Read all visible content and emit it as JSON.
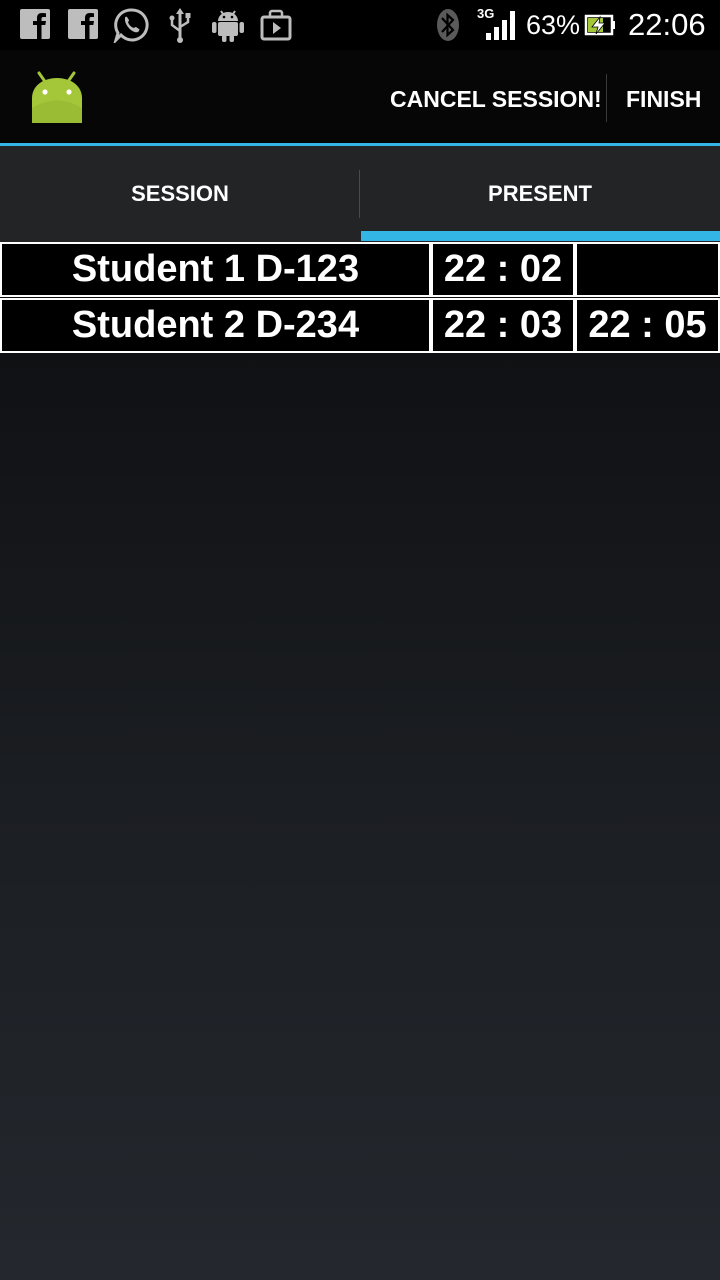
{
  "status_bar": {
    "network": "3G",
    "battery": "63%",
    "time": "22:06",
    "left_icons": [
      "facebook-icon",
      "facebook-icon",
      "whatsapp-icon",
      "usb-icon",
      "android-debug-icon",
      "play-store-icon"
    ]
  },
  "action_bar": {
    "cancel_label": "CANCEL SESSION!",
    "finish_label": "FINISH"
  },
  "tabs": [
    {
      "label": "SESSION",
      "selected": false
    },
    {
      "label": "PRESENT",
      "selected": true
    }
  ],
  "rows": [
    {
      "student": "Student 1 D-123",
      "time_in": "22 : 02",
      "time_out": ""
    },
    {
      "student": "Student 2 D-234",
      "time_in": "22 : 03",
      "time_out": "22 : 05"
    }
  ],
  "colors": {
    "accent": "#33b5e5",
    "android_green": "#a4c639"
  }
}
